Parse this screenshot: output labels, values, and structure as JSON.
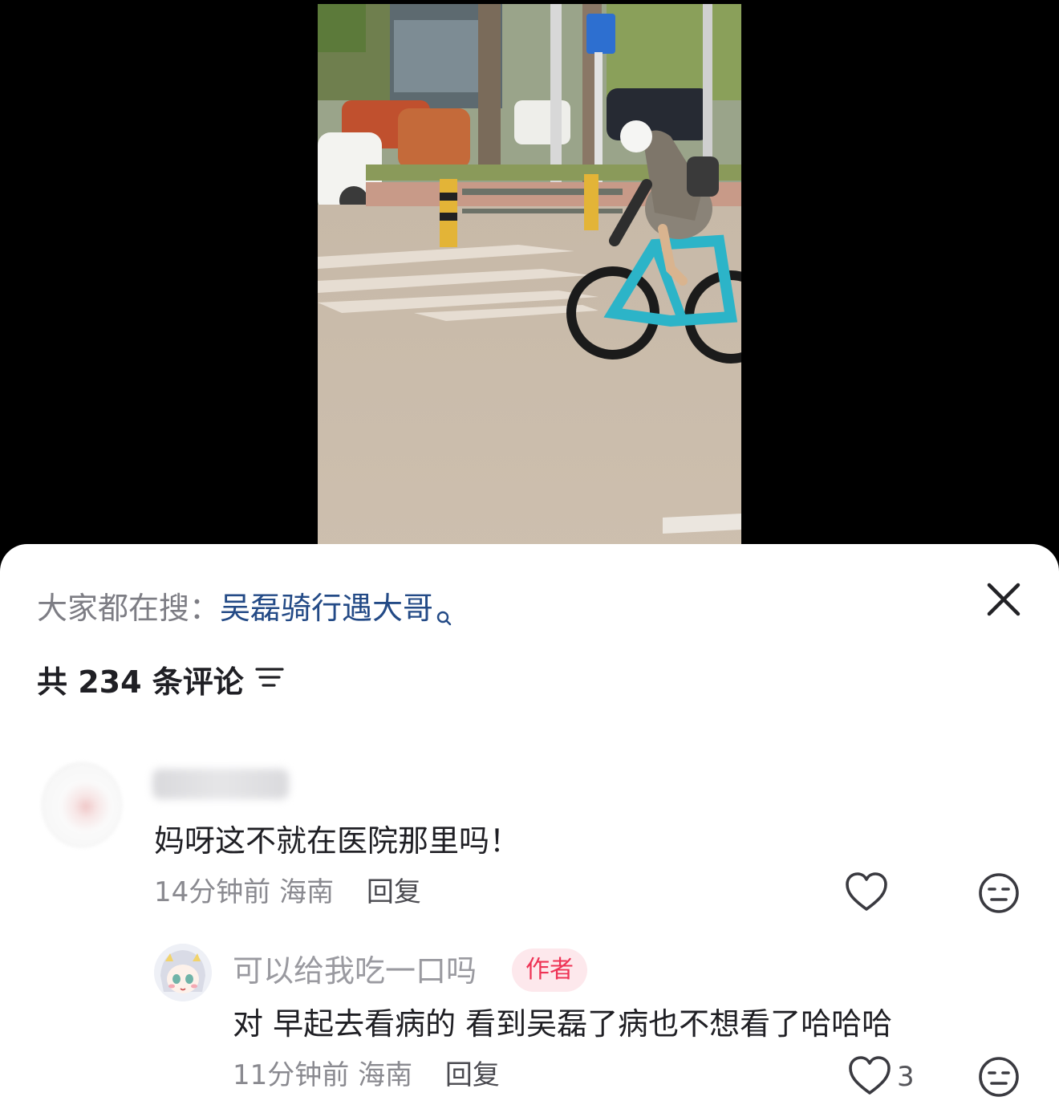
{
  "search": {
    "prefix": "大家都在搜：",
    "term": "吴磊骑行遇大哥"
  },
  "comments_header": {
    "count_label": "共 234 条评论"
  },
  "comments": [
    {
      "username": "",
      "text": "妈呀这不就在医院那里吗！",
      "time": "14分钟前",
      "location": "海南",
      "reply_label": "回复",
      "replies": [
        {
          "username": "可以给我吃一口吗",
          "badge": "作者",
          "text": "对 早起去看病的 看到吴磊了病也不想看了哈哈哈",
          "time": "11分钟前",
          "location": "海南",
          "reply_label": "回复",
          "like_count": "3"
        }
      ]
    }
  ],
  "icons": {
    "search": "search-icon",
    "close": "close-icon",
    "sort": "sort-icon",
    "like": "heart-icon",
    "dislike": "meh-face-icon"
  },
  "colors": {
    "sheet_bg": "#ffffff",
    "search_term": "#234a86",
    "author_badge_bg": "#fde8ec",
    "author_badge_text": "#ee3355",
    "muted_text": "#8a8a90"
  }
}
